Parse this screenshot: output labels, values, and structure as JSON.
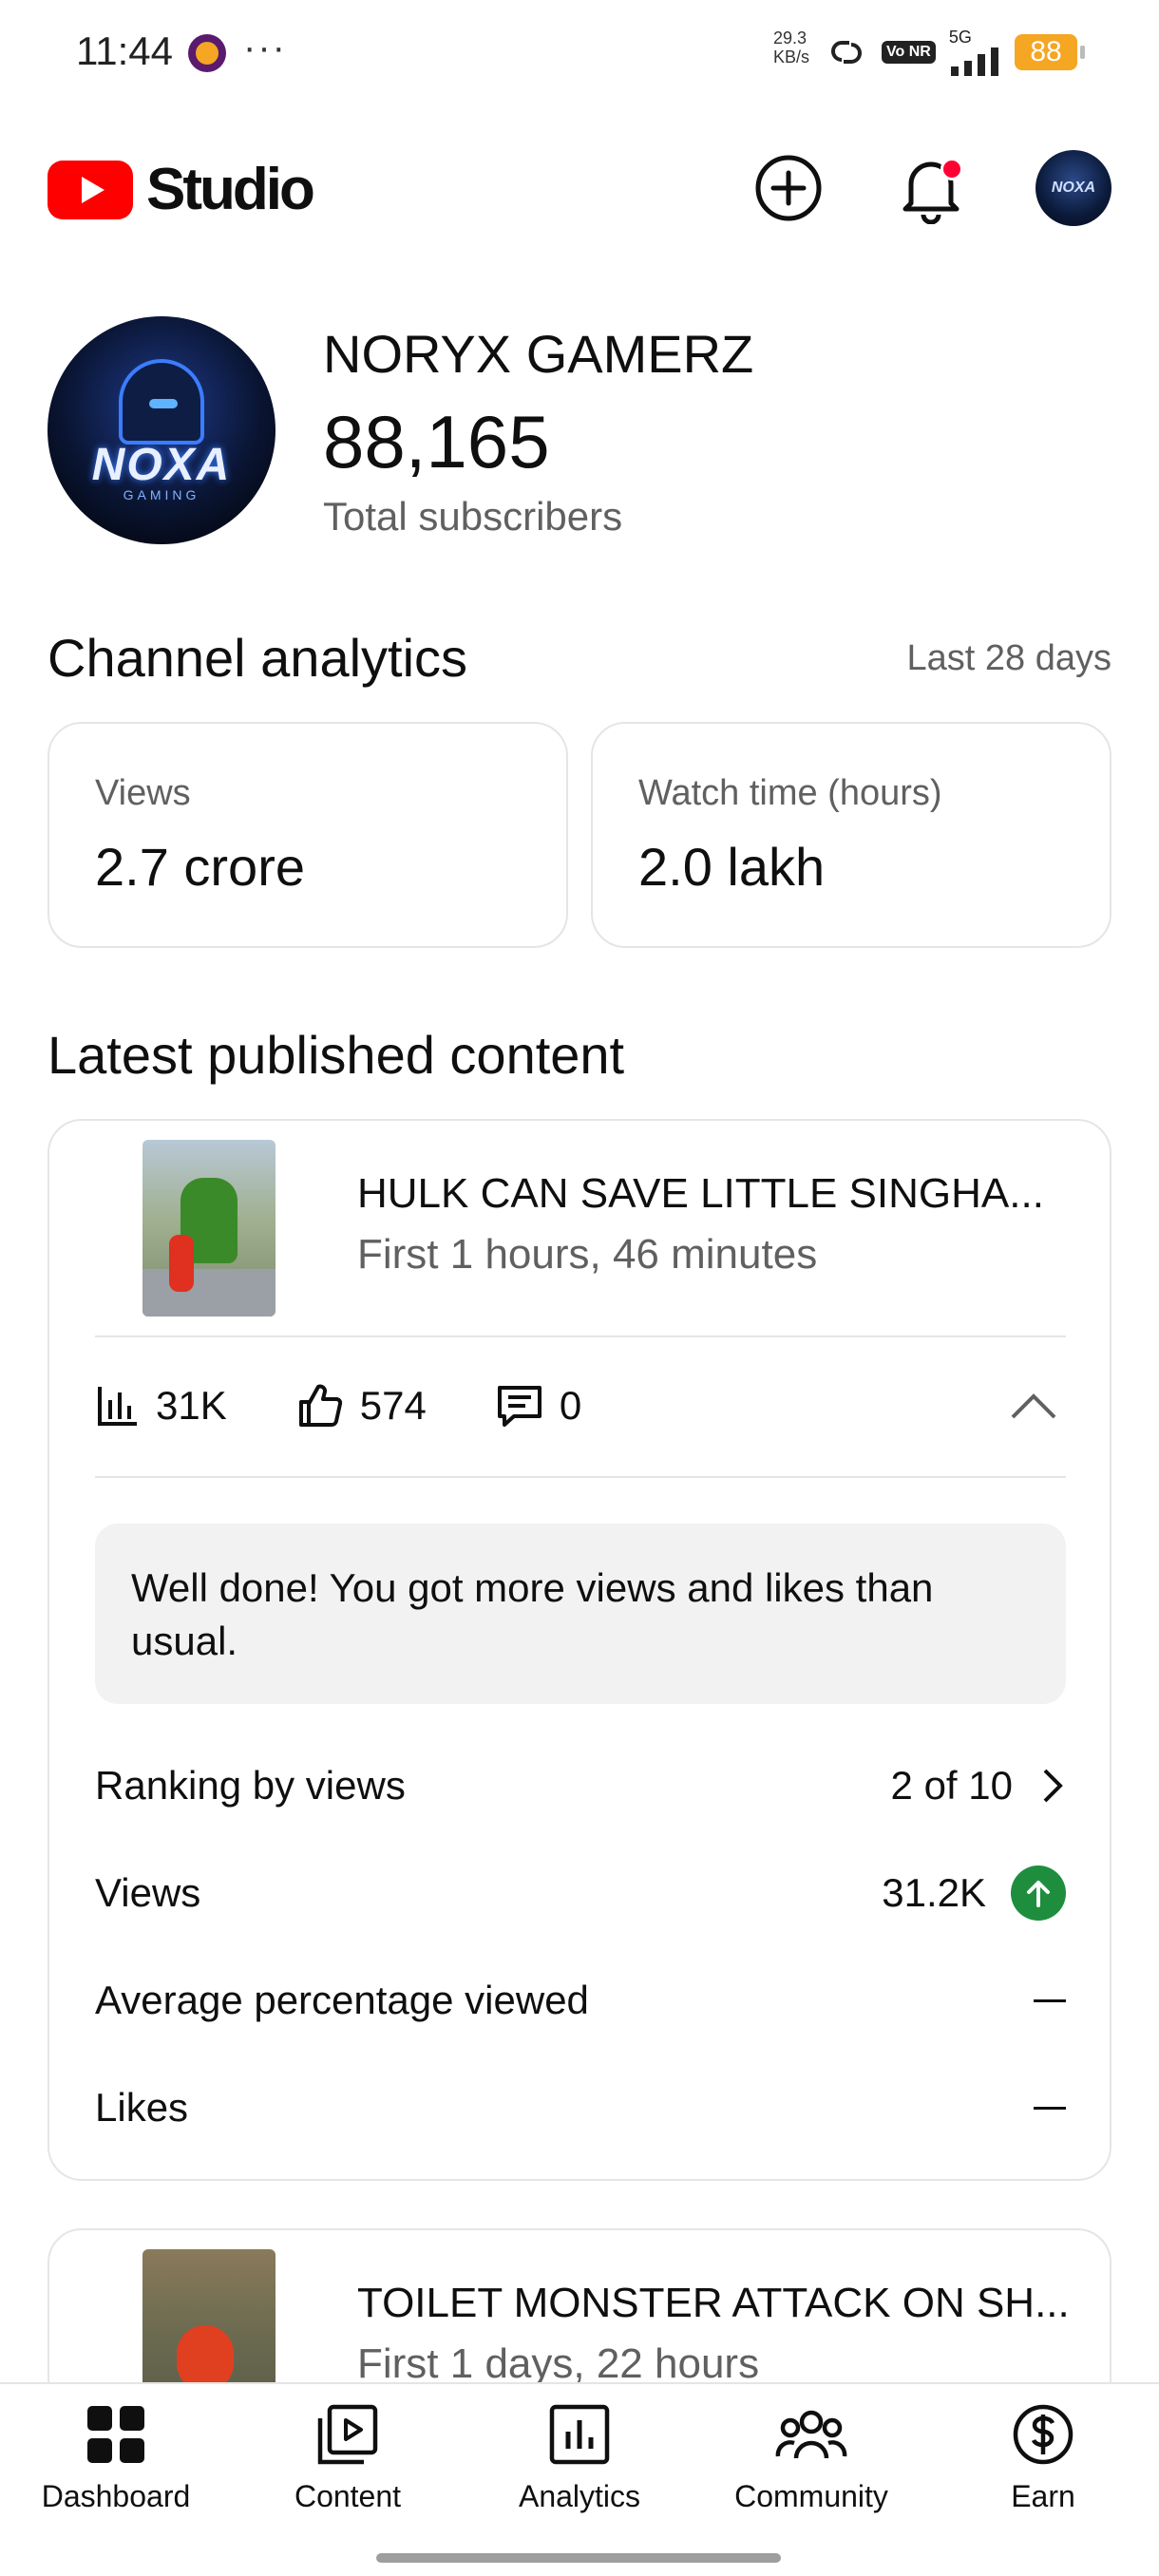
{
  "status_bar": {
    "time": "11:44",
    "dots": "···",
    "net_speed": "29.3",
    "net_unit": "KB/s",
    "volte": "Vo NR",
    "network": "5G",
    "battery": "88"
  },
  "header": {
    "brand": "Studio",
    "avatar_text": "NOXA"
  },
  "channel": {
    "name": "NORYX GAMERZ",
    "subscribers": "88,165",
    "subscribers_label": "Total subscribers",
    "avatar_brand": "NOXA",
    "avatar_sub": "GAMING"
  },
  "channel_analytics": {
    "title": "Channel analytics",
    "range": "Last 28 days",
    "cards": [
      {
        "label": "Views",
        "value": "2.7 crore"
      },
      {
        "label": "Watch time (hours)",
        "value": "2.0 lakh"
      }
    ]
  },
  "latest": {
    "title": "Latest published content",
    "items": [
      {
        "title": "HULK CAN SAVE LITTLE SINGHA...",
        "time": "First 1 hours, 46 minutes",
        "views": "31K",
        "likes": "574",
        "comments": "0",
        "insight": "Well done! You got more views and likes than usual.",
        "rows": [
          {
            "label": "Ranking by views",
            "value": "2 of 10"
          },
          {
            "label": "Views",
            "value": "31.2K"
          },
          {
            "label": "Average percentage viewed",
            "value": ""
          },
          {
            "label": "Likes",
            "value": ""
          }
        ]
      },
      {
        "title": "TOILET MONSTER ATTACK ON SH...",
        "time": "First 1 days, 22 hours"
      }
    ]
  },
  "nav": [
    {
      "label": "Dashboard",
      "icon": "dashboard-icon"
    },
    {
      "label": "Content",
      "icon": "content-icon"
    },
    {
      "label": "Analytics",
      "icon": "analytics-icon"
    },
    {
      "label": "Community",
      "icon": "community-icon"
    },
    {
      "label": "Earn",
      "icon": "earn-icon"
    }
  ],
  "colors": {
    "brand_red": "#ff0000",
    "positive_green": "#1e8e3e",
    "secondary_text": "#606060",
    "battery": "#f5a623"
  }
}
